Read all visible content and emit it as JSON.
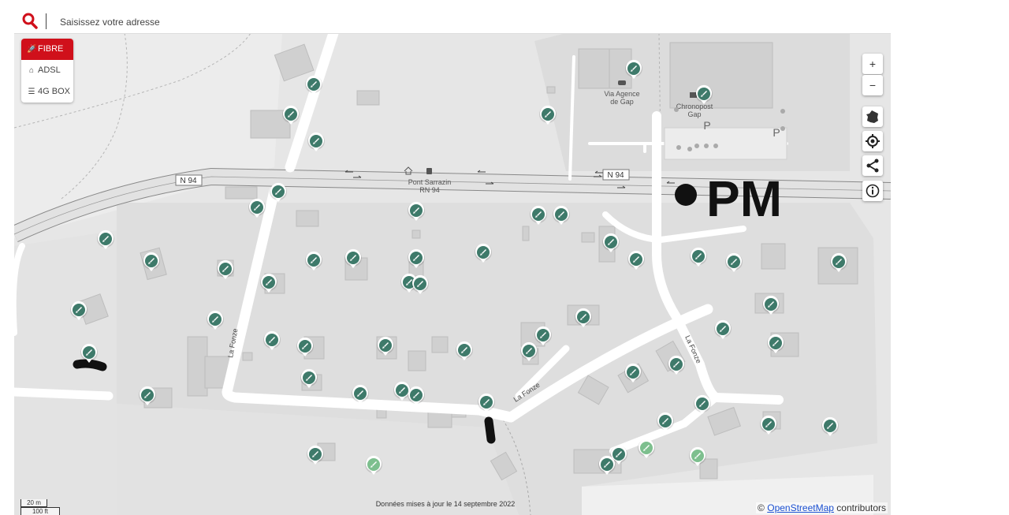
{
  "search": {
    "placeholder": "Saisissez votre adresse"
  },
  "tech_tabs": [
    {
      "label": "FIBRE",
      "icon": "rocket-icon",
      "active": true
    },
    {
      "label": "ADSL",
      "icon": "home-icon",
      "active": false
    },
    {
      "label": "4G BOX",
      "icon": "wifi-icon",
      "active": false
    }
  ],
  "controls": {
    "zoom_in": "+",
    "zoom_out": "−"
  },
  "map_labels": {
    "road_n94_left": "N 94",
    "road_n94_right": "N 94",
    "bus_stop_name": "Pont Sarrazin",
    "bus_stop_route": "RN 94",
    "poi_via_line1": "Via Agence",
    "poi_via_line2": "de Gap",
    "poi_chrono_line1": "Chronopost",
    "poi_chrono_line2": "Gap",
    "parking_1": "P",
    "parking_2": "P",
    "street_fonze_1": "La Fonze",
    "street_fonze_2": "La Fonze",
    "street_fonze_3": "La Fonze",
    "annotation_pm": "PM"
  },
  "scale": {
    "metric": "20 m",
    "imperial": "100 ft"
  },
  "attribution": {
    "prefix": "©",
    "link": "OpenStreetMap",
    "suffix": "contributors"
  },
  "footer": "Données mises à jour le 14 septembre 2022",
  "colors": {
    "brand_red": "#d0101b",
    "marker_green": "#3e7a6a",
    "marker_light": "#7dbf8e"
  }
}
